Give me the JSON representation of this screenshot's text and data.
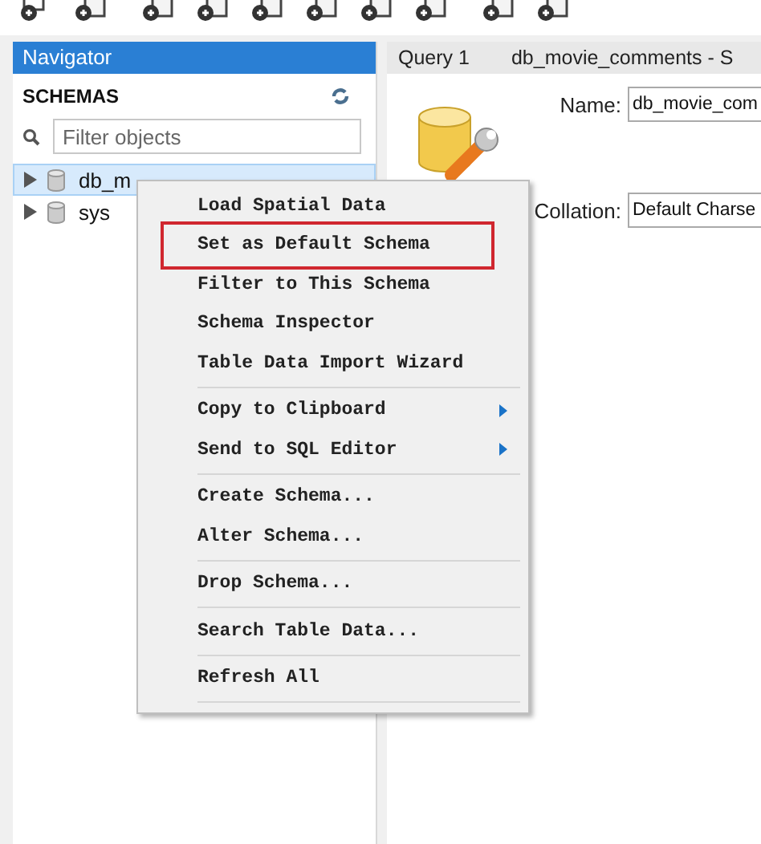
{
  "navigator": {
    "title": "Navigator",
    "section": "SCHEMAS",
    "filter": {
      "placeholder": "Filter objects"
    },
    "schemas": [
      {
        "name": "db_m",
        "selected": true,
        "expanded": false
      },
      {
        "name": "sys",
        "selected": false,
        "expanded": false
      }
    ]
  },
  "tabs": [
    {
      "label": "Query 1"
    },
    {
      "label": "db_movie_comments - S"
    }
  ],
  "editor": {
    "fields": [
      {
        "label": "Name:",
        "value": "db_movie_com"
      },
      {
        "label": "Collation:",
        "value": "Default Charse"
      }
    ]
  },
  "context_menu": {
    "groups": [
      [
        {
          "label": "Load Spatial Data",
          "submenu": false,
          "marked": false
        },
        {
          "label": "Set as Default Schema",
          "submenu": false,
          "marked": true
        },
        {
          "label": "Filter to This Schema",
          "submenu": false,
          "marked": false
        },
        {
          "label": "Schema Inspector",
          "submenu": false,
          "marked": false
        },
        {
          "label": "Table Data Import Wizard",
          "submenu": false,
          "marked": false
        }
      ],
      [
        {
          "label": "Copy to Clipboard",
          "submenu": true,
          "marked": false
        },
        {
          "label": "Send to SQL Editor",
          "submenu": true,
          "marked": false
        }
      ],
      [
        {
          "label": "Create Schema...",
          "submenu": false,
          "marked": false
        },
        {
          "label": "Alter Schema...",
          "submenu": false,
          "marked": false
        }
      ],
      [
        {
          "label": "Drop Schema...",
          "submenu": false,
          "marked": false
        }
      ],
      [
        {
          "label": "Search Table Data...",
          "submenu": false,
          "marked": false
        }
      ],
      [
        {
          "label": "Refresh All",
          "submenu": false,
          "marked": false
        }
      ]
    ]
  }
}
